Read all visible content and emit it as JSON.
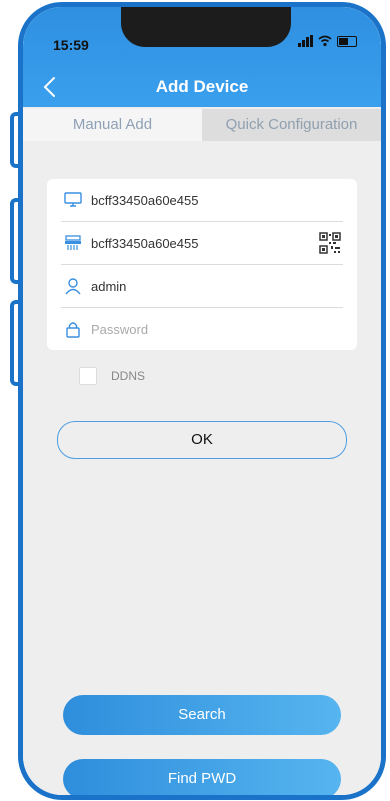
{
  "status_bar": {
    "time": "15:59"
  },
  "nav": {
    "title": "Add Device"
  },
  "tabs": [
    {
      "label": "Manual Add"
    },
    {
      "label": "Quick Configuration"
    }
  ],
  "form": {
    "device_name": "bcff33450a60e455",
    "device_id": "bcff33450a60e455",
    "username": "admin",
    "password_placeholder": "Password"
  },
  "ddns": {
    "label": "DDNS",
    "checked": false
  },
  "buttons": {
    "ok": "OK",
    "search": "Search",
    "find_pwd": "Find PWD"
  },
  "colors": {
    "accent": "#2f8fe0",
    "frame": "#1a73c9",
    "background": "#eeeeee"
  },
  "icons": [
    "back-chevron-icon",
    "monitor-icon",
    "device-id-icon",
    "qr-code-icon",
    "user-icon",
    "lock-icon"
  ]
}
